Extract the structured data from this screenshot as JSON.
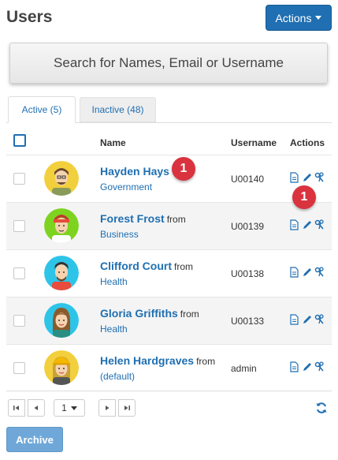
{
  "header": {
    "title": "Users",
    "actions_label": "Actions"
  },
  "search": {
    "placeholder": "Search for Names, Email or Username"
  },
  "tabs": [
    {
      "label": "Active (5)",
      "active": true
    },
    {
      "label": "Inactive (48)",
      "active": false
    }
  ],
  "table": {
    "columns": {
      "name": "Name",
      "username": "Username",
      "actions": "Actions"
    },
    "rows": [
      {
        "name": "Hayden Hays",
        "from": "",
        "group": "Government",
        "username": "U00140",
        "avatar_bg": "#f2cf3c"
      },
      {
        "name": "Forest Frost",
        "from": "from",
        "group": "Business",
        "username": "U00139",
        "avatar_bg": "#7ed321"
      },
      {
        "name": "Clifford Court",
        "from": "from",
        "group": "Health",
        "username": "U00138",
        "avatar_bg": "#2ec4e8"
      },
      {
        "name": "Gloria Griffiths",
        "from": "from",
        "group": "Health",
        "username": "U00133",
        "avatar_bg": "#2ec4e8"
      },
      {
        "name": "Helen Hardgraves",
        "from": "from",
        "group": "(default)",
        "username": "admin",
        "avatar_bg": "#f2cf3c"
      }
    ]
  },
  "badges": {
    "name_badge": "1",
    "actions_badge": "1"
  },
  "pagination": {
    "current_page": "1"
  },
  "footer": {
    "archive_label": "Archive"
  },
  "colors": {
    "primary": "#1f6fb2",
    "badge": "#d9333f",
    "archive": "#6fa8d8"
  },
  "icons": [
    "caret-down-icon",
    "document-icon",
    "pencil-icon",
    "keys-icon",
    "first-page-icon",
    "prev-page-icon",
    "next-page-icon",
    "last-page-icon",
    "refresh-icon"
  ]
}
